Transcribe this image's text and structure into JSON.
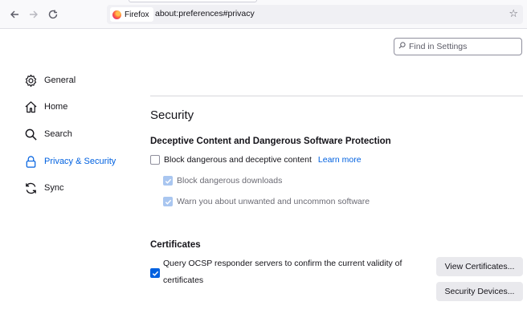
{
  "browser": {
    "identity_label": "Firefox",
    "url": "about:preferences#privacy",
    "icons": [
      "back-icon",
      "forward-icon",
      "reload-icon",
      "bookmark-star-icon"
    ]
  },
  "search": {
    "placeholder": "Find in Settings"
  },
  "sidebar": {
    "items": [
      {
        "label": "General",
        "icon": "gear-icon",
        "selected": false
      },
      {
        "label": "Home",
        "icon": "home-icon",
        "selected": false
      },
      {
        "label": "Search",
        "icon": "magnifier-icon",
        "selected": false
      },
      {
        "label": "Privacy & Security",
        "icon": "lock-icon",
        "selected": true
      },
      {
        "label": "Sync",
        "icon": "sync-icon",
        "selected": false
      }
    ]
  },
  "security": {
    "title": "Security",
    "deceptive": {
      "heading": "Deceptive Content and Dangerous Software Protection",
      "block_label": "Block dangerous and deceptive content",
      "block_checked": false,
      "learn_more": "Learn more",
      "downloads_label": "Block dangerous downloads",
      "downloads_checked": true,
      "warn_label": "Warn you about unwanted and uncommon software",
      "warn_checked": true
    },
    "certificates": {
      "heading": "Certificates",
      "ocsp_line1": "Query OCSP responder servers to confirm the current validity of",
      "ocsp_line2": "certificates",
      "ocsp_checked": true,
      "view_button": "View Certificates...",
      "devices_button": "Security Devices..."
    }
  },
  "colors": {
    "accent": "#0061e0",
    "text": "#15141a",
    "muted": "#6b6b74"
  }
}
